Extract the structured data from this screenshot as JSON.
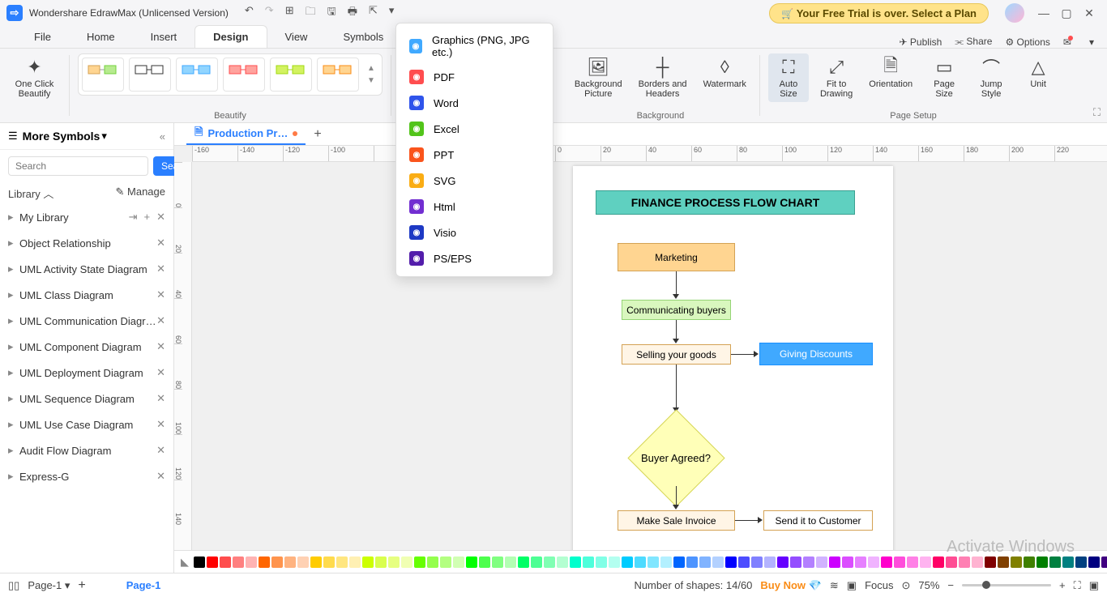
{
  "title": "Wondershare EdrawMax (Unlicensed Version)",
  "trial_msg": "Your Free Trial is over. Select a Plan",
  "tabs": [
    "File",
    "Home",
    "Insert",
    "Design",
    "View",
    "Symbols"
  ],
  "active_tab": "Design",
  "top_right": {
    "publish": "Publish",
    "share": "Share",
    "options": "Options"
  },
  "ribbon": {
    "oneclick": "One Click\nBeautify",
    "beautify_caption": "Beautify",
    "bg_picture": "Background\nPicture",
    "borders": "Borders and\nHeaders",
    "watermark": "Watermark",
    "bg_caption": "Background",
    "autosize": "Auto\nSize",
    "fit": "Fit to\nDrawing",
    "orient": "Orientation",
    "pagesize": "Page\nSize",
    "jump": "Jump\nStyle",
    "unit": "Unit",
    "pagesetup_caption": "Page Setup"
  },
  "doc_tab": "Production Pr…",
  "left": {
    "title": "More Symbols",
    "search_ph": "Search",
    "search_btn": "Search",
    "library": "Library",
    "manage": "Manage",
    "items": [
      "My Library",
      "Object Relationship",
      "UML Activity State Diagram",
      "UML Class Diagram",
      "UML Communication Diagr…",
      "UML Component Diagram",
      "UML Deployment Diagram",
      "UML Sequence Diagram",
      "UML Use Case Diagram",
      "Audit Flow Diagram",
      "Express-G"
    ]
  },
  "ruler_h": [
    "-160",
    "-140",
    "-120",
    "-100",
    "",
    "",
    "",
    "",
    "0",
    "20",
    "40",
    "60",
    "80",
    "100",
    "120",
    "140",
    "160",
    "180",
    "200",
    "220"
  ],
  "ruler_v": [
    "0",
    "20",
    "40",
    "60",
    "80",
    "100",
    "120",
    "140"
  ],
  "flow": {
    "title": "FINANCE PROCESS FLOW CHART",
    "n1": "Marketing",
    "n2": "Communicating buyers",
    "n3": "Selling your goods",
    "n3b": "Giving Discounts",
    "n4": "Buyer Agreed?",
    "n5": "Make Sale Invoice",
    "n5b": "Send it to Customer"
  },
  "export_items": [
    {
      "label": "Graphics (PNG, JPG etc.)",
      "color": "#40a9ff"
    },
    {
      "label": "PDF",
      "color": "#ff4d4f"
    },
    {
      "label": "Word",
      "color": "#2f54eb"
    },
    {
      "label": "Excel",
      "color": "#52c41a"
    },
    {
      "label": "PPT",
      "color": "#fa541c"
    },
    {
      "label": "SVG",
      "color": "#faad14"
    },
    {
      "label": "Html",
      "color": "#722ed1"
    },
    {
      "label": "Visio",
      "color": "#1d39c4"
    },
    {
      "label": "PS/EPS",
      "color": "#531dab"
    }
  ],
  "status": {
    "page": "Page-1",
    "page_tab": "Page-1",
    "shapes": "Number of shapes: 14/60",
    "buy": "Buy Now",
    "focus": "Focus",
    "zoom": "75%"
  },
  "watermark": "Activate Windows",
  "colors": [
    "#000000",
    "#ff0000",
    "#ff4d4d",
    "#ff8080",
    "#ffb3b3",
    "#ff6600",
    "#ff944d",
    "#ffb380",
    "#ffd1b3",
    "#ffcc00",
    "#ffdb4d",
    "#ffe680",
    "#fff0b3",
    "#ccff00",
    "#d9ff4d",
    "#e6ff80",
    "#f0ffb3",
    "#66ff00",
    "#94ff4d",
    "#b3ff80",
    "#d1ffb3",
    "#00ff00",
    "#4dff4d",
    "#80ff80",
    "#b3ffb3",
    "#00ff66",
    "#4dff94",
    "#80ffb3",
    "#b3ffd1",
    "#00ffcc",
    "#4dffdb",
    "#80ffe6",
    "#b3fff0",
    "#00ccff",
    "#4ddbff",
    "#80e6ff",
    "#b3f0ff",
    "#0066ff",
    "#4d94ff",
    "#80b3ff",
    "#b3d1ff",
    "#0000ff",
    "#4d4dff",
    "#8080ff",
    "#b3b3ff",
    "#6600ff",
    "#944dff",
    "#b380ff",
    "#d1b3ff",
    "#cc00ff",
    "#db4dff",
    "#e680ff",
    "#f0b3ff",
    "#ff00cc",
    "#ff4ddb",
    "#ff80e6",
    "#ffb3f0",
    "#ff0066",
    "#ff4d94",
    "#ff80b3",
    "#ffb3d1",
    "#800000",
    "#804000",
    "#808000",
    "#408000",
    "#008000",
    "#008040",
    "#008080",
    "#004080",
    "#000080",
    "#400080",
    "#800080",
    "#800040"
  ]
}
